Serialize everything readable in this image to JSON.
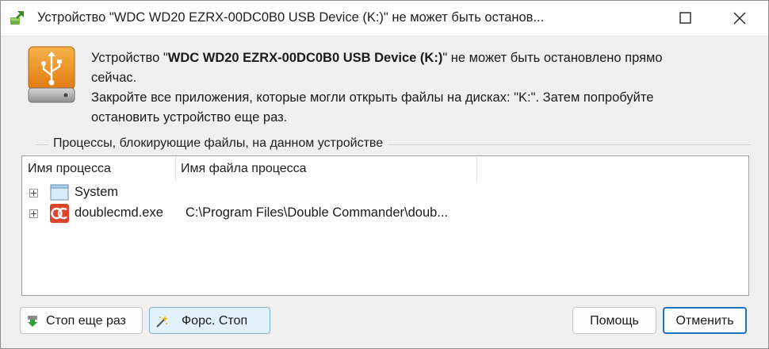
{
  "window": {
    "title": "Устройство \"WDC WD20 EZRX-00DC0B0 USB Device (K:)\" не может быть останов..."
  },
  "message": {
    "line1_prefix": "Устройство \"",
    "device_name": "WDC WD20 EZRX-00DC0B0 USB Device (K:)",
    "line1_suffix": "\" не может быть остановлено прямо",
    "line2": "сейчас.",
    "line3": "Закройте все приложения, которые могли открыть файлы на дисках: \"K:\". Затем попробуйте",
    "line4": "остановить устройство еще раз."
  },
  "processes": {
    "group_label": "Процессы, блокирующие файлы, на данном устройстве",
    "columns": [
      "Имя процесса",
      "Имя файла процесса"
    ],
    "rows": [
      {
        "name": "System",
        "path": "",
        "icon": "window-icon"
      },
      {
        "name": "doublecmd.exe",
        "path": "C:\\Program Files\\Double Commander\\doub...",
        "icon": "double-commander-icon"
      }
    ]
  },
  "buttons": {
    "stop_again": "Стоп еще раз",
    "force_stop": "Форс. Стоп",
    "help": "Помощь",
    "cancel": "Отменить"
  },
  "colors": {
    "accent": "#1f6fc2",
    "drive_orange": "#f0901e",
    "force_button_bg": "#e3f1fb"
  }
}
